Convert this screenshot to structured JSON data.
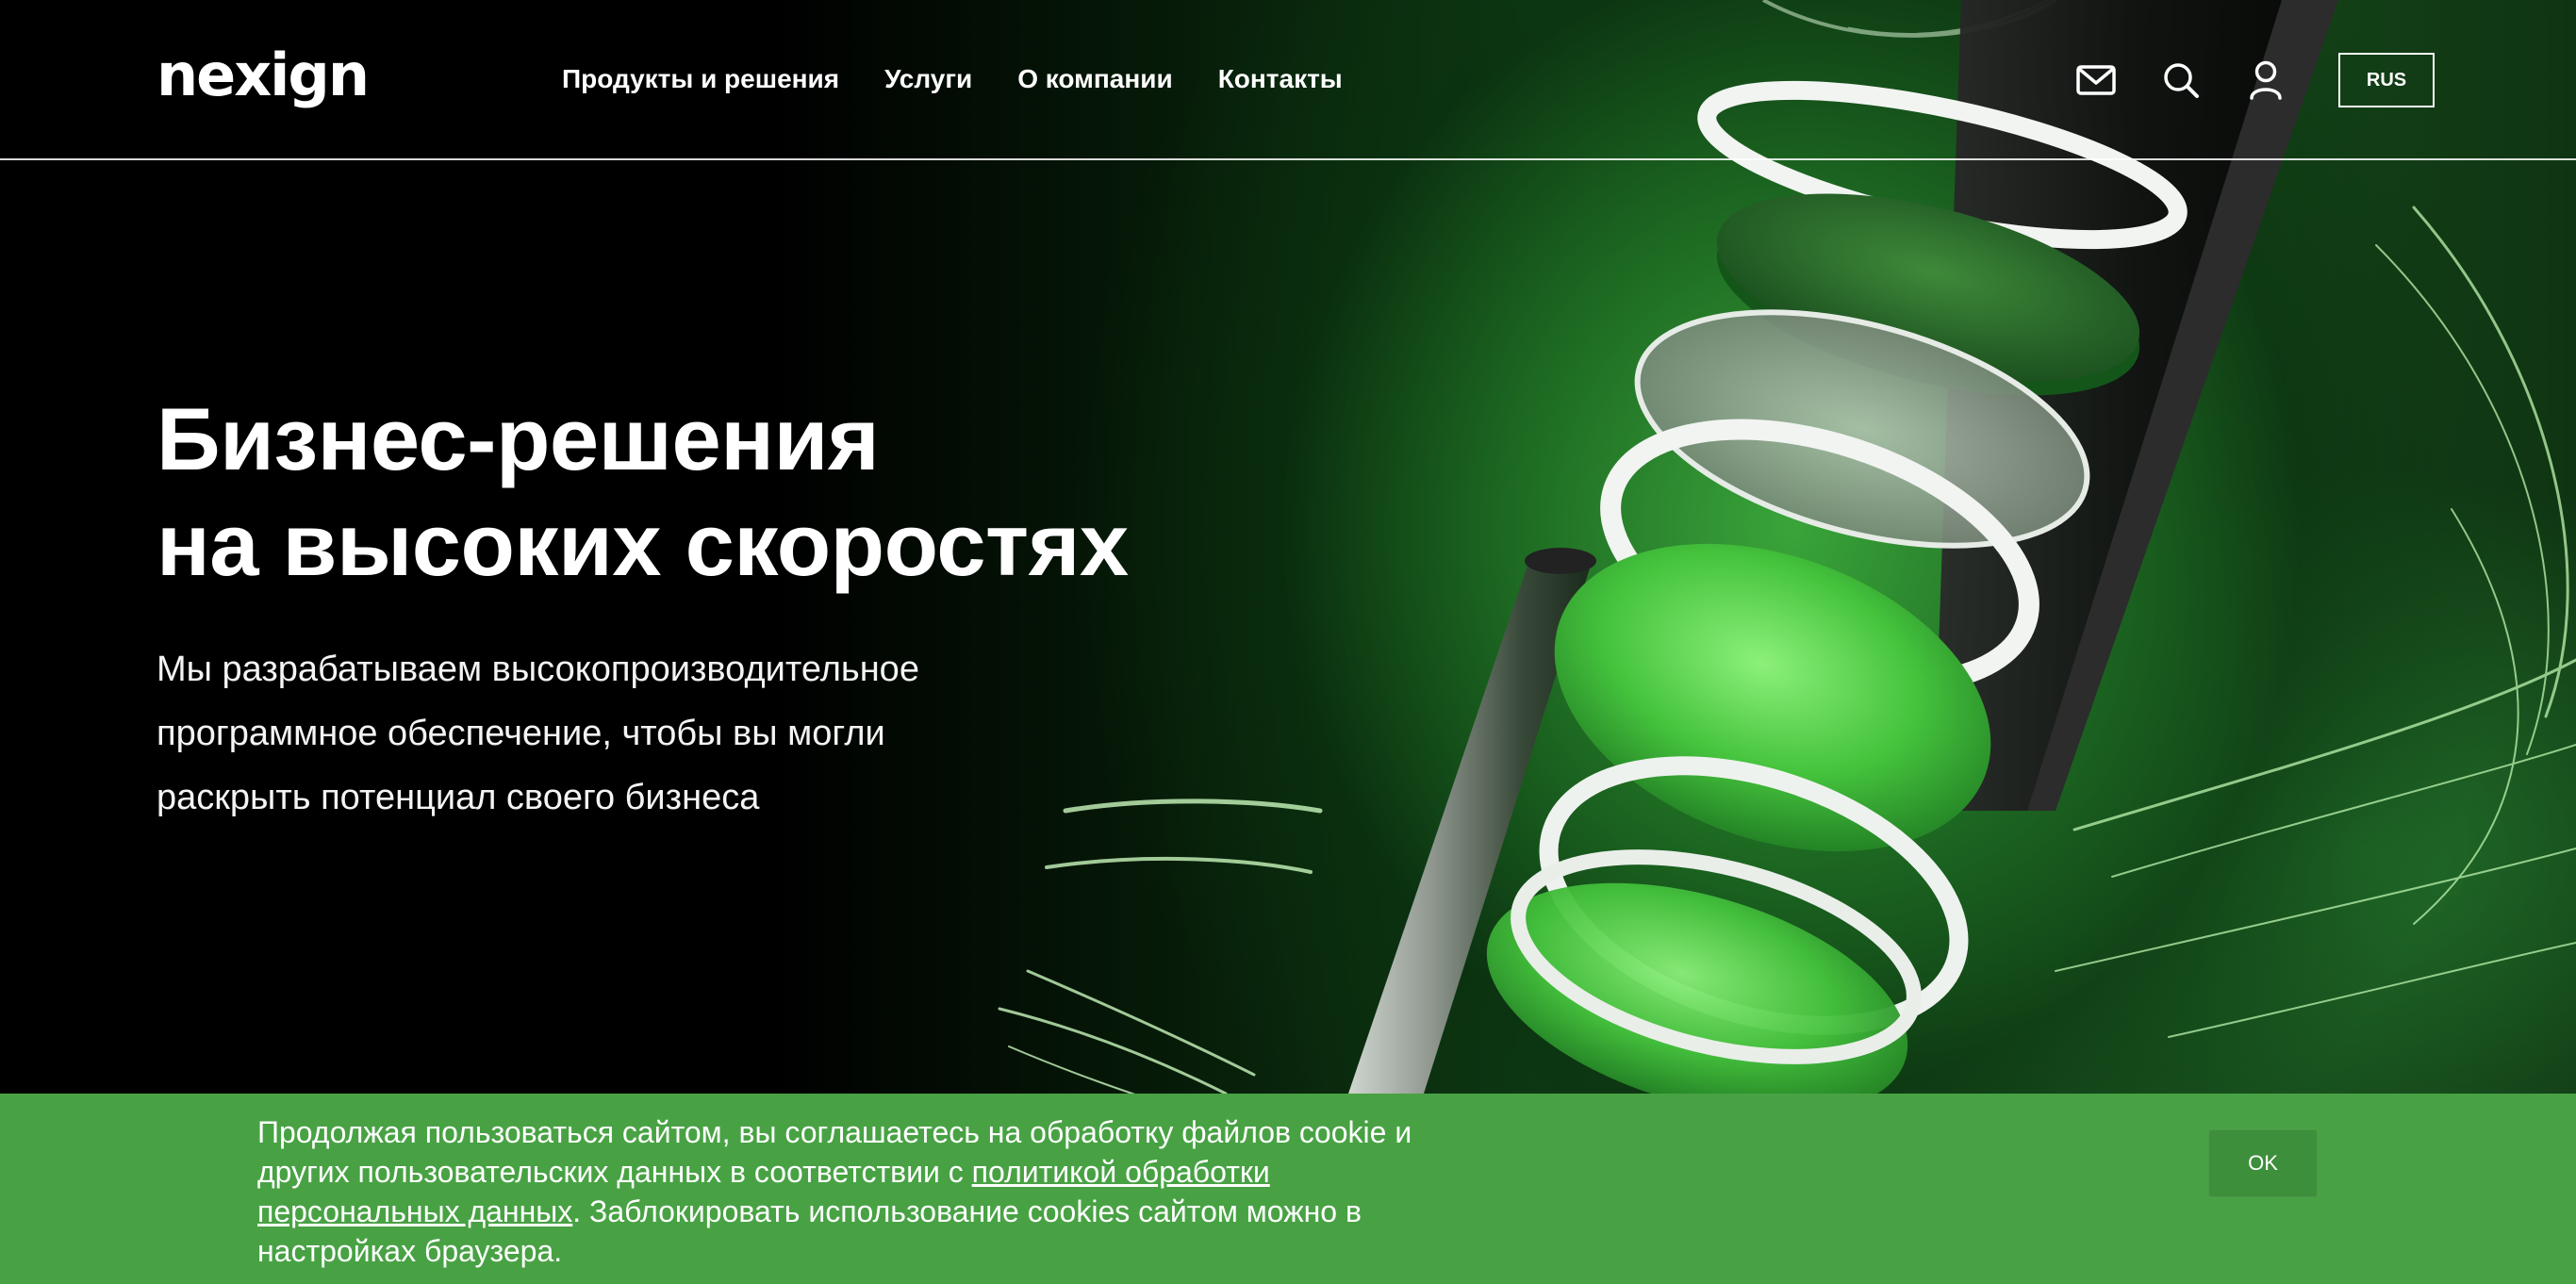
{
  "brand": {
    "logo_text": "nexign"
  },
  "nav": {
    "items": [
      {
        "label": "Продукты и решения"
      },
      {
        "label": "Услуги"
      },
      {
        "label": "О компании"
      },
      {
        "label": "Контакты"
      }
    ]
  },
  "header_tools": {
    "icons": [
      "mail-icon",
      "search-icon",
      "user-icon"
    ],
    "language_label": "RUS"
  },
  "hero": {
    "title_line_1": "Бизнес-решения",
    "title_line_2": "на высоких скоростях",
    "subtitle_line_1": "Мы разрабатываем высокопроизводительное",
    "subtitle_line_2": "программное обеспечение, чтобы вы могли",
    "subtitle_line_3": "раскрыть потенциал своего бизнеса"
  },
  "cookie_banner": {
    "line_1": "Продолжая пользоваться сайтом, вы соглашаетесь на обработку файлов cookie и",
    "line_2_before": "других пользовательских данных в соответствии с ",
    "link_part_1": "политикой обработки",
    "link_part_2": "персональных данных",
    "line_3_after": ". Заблокировать использование cookies сайтом можно в",
    "line_4": "настройках браузера.",
    "ok_label": "OK"
  },
  "colors": {
    "background": "#000000",
    "accent_green": "#48a244",
    "button_green": "#3e8f3b",
    "text": "#ffffff"
  }
}
